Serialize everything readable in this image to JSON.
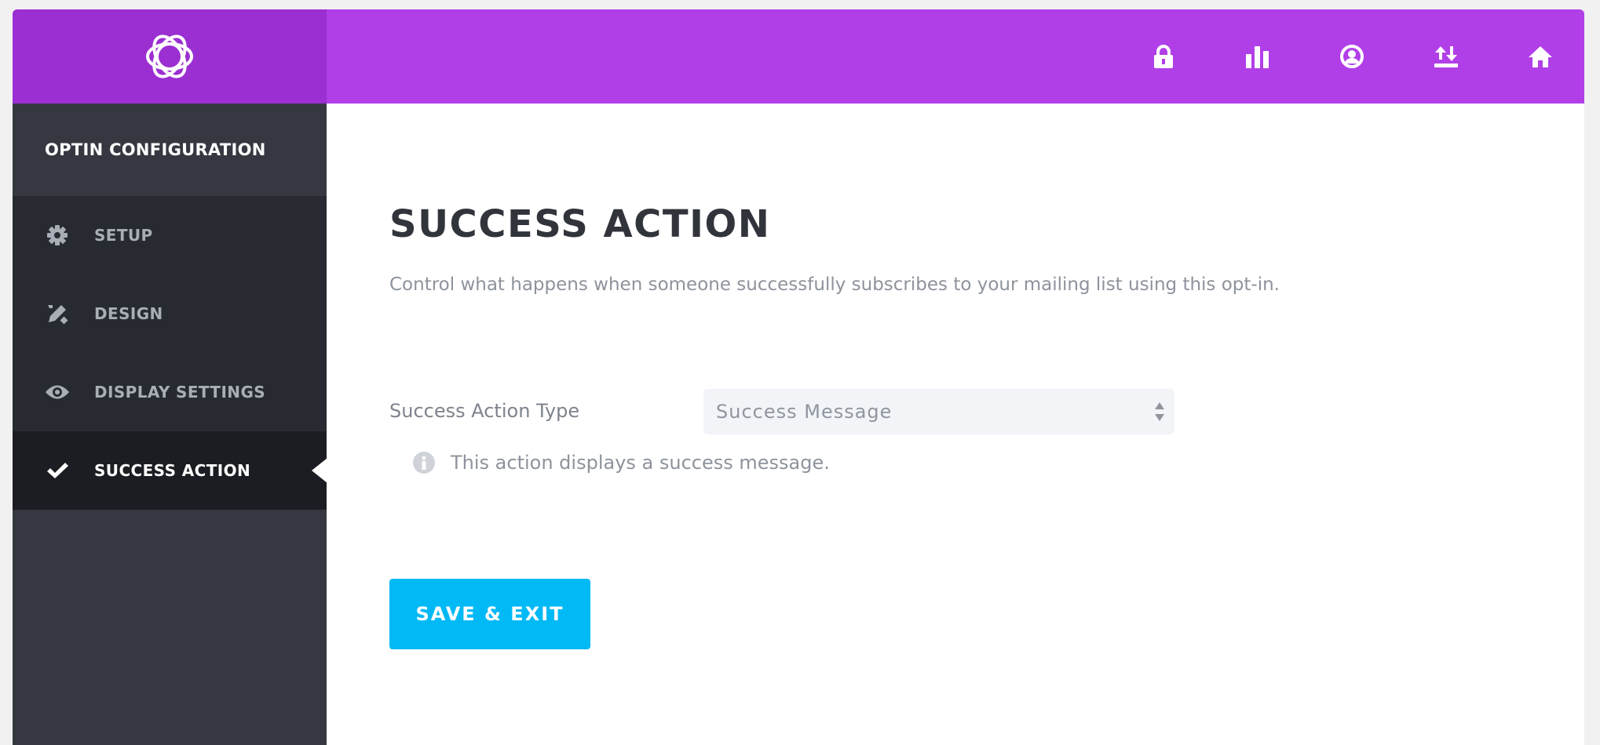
{
  "header": {
    "logo_icon": "bloom-logo-icon",
    "icons": [
      "lock-icon",
      "stats-bars-icon",
      "account-circle-icon",
      "import-export-icon",
      "home-icon"
    ],
    "colors": {
      "bar": "#b13fe8",
      "logo_box": "#9b2fd2"
    }
  },
  "sidebar": {
    "title": "OPTIN CONFIGURATION",
    "items": [
      {
        "label": "SETUP",
        "icon": "gear-icon",
        "active": false
      },
      {
        "label": "DESIGN",
        "icon": "design-pencil-icon",
        "active": false
      },
      {
        "label": "DISPLAY SETTINGS",
        "icon": "eye-icon",
        "active": false
      },
      {
        "label": "SUCCESS ACTION",
        "icon": "check-icon",
        "active": true
      }
    ]
  },
  "main": {
    "title": "SUCCESS ACTION",
    "description": "Control what happens when someone successfully subscribes to your mailing list using this opt-in.",
    "field": {
      "label": "Success Action Type",
      "value": "Success Message",
      "help": "This action displays a success message."
    },
    "save_label": "SAVE & EXIT",
    "colors": {
      "accent": "#00b9f5"
    }
  }
}
